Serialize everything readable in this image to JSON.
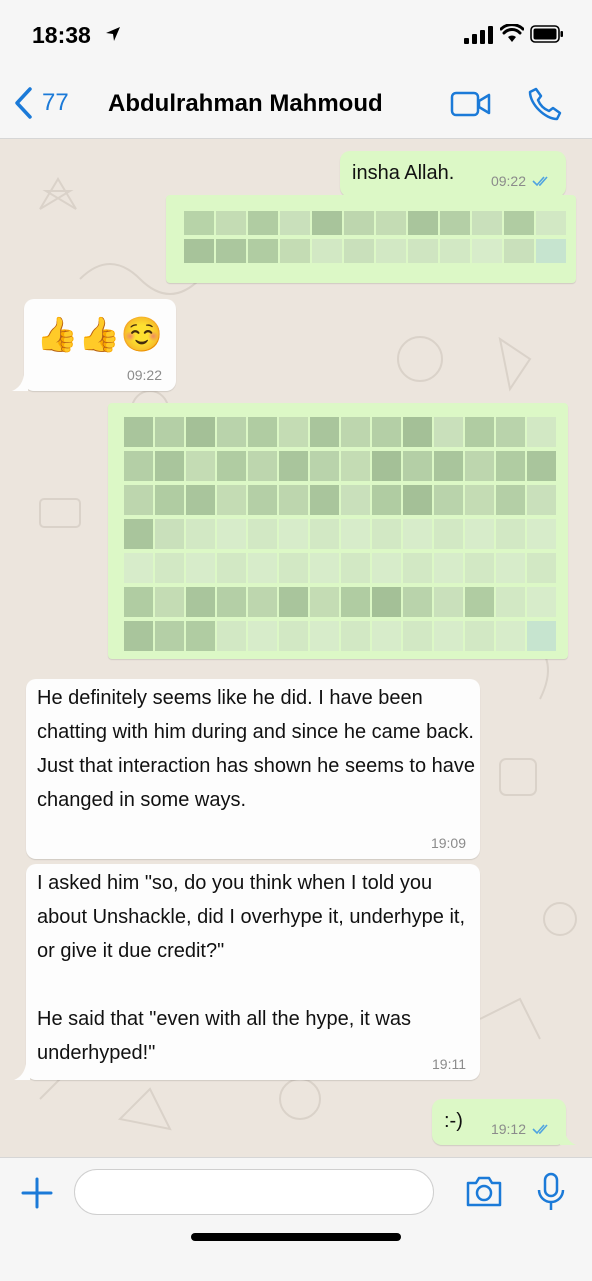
{
  "status": {
    "time": "18:38"
  },
  "header": {
    "back_count": "77",
    "contact_name": "Abdulrahman Mahmoud"
  },
  "messages": [
    {
      "direction": "out",
      "text": "insha Allah.",
      "time": "09:22",
      "read": true
    },
    {
      "direction": "out",
      "text": "",
      "time": "",
      "redacted": true
    },
    {
      "direction": "in",
      "text": "👍👍☺️",
      "time": "09:22"
    },
    {
      "direction": "out",
      "text": "",
      "time": "",
      "redacted": true
    },
    {
      "direction": "in",
      "text": "He definitely seems like he did. I have been chatting with him during and since he came back. Just that interaction has shown he seems to have changed in some ways.",
      "time": "19:09"
    },
    {
      "direction": "in",
      "text": "I asked him \"so, do you think when I told you about Unshackle, did I overhype it, underhype it, or give it due credit?\"\n\nHe said that \"even with all the hype, it was underhyped!\"",
      "time": "19:11"
    },
    {
      "direction": "out",
      "text": ":-)",
      "time": "19:12",
      "read": true
    }
  ],
  "input": {
    "placeholder": ""
  },
  "colors": {
    "accent": "#1b7ad8",
    "outgoing_bubble": "#dcf8c6",
    "incoming_bubble": "#fdfdfd",
    "chat_background": "#ece5dd",
    "read_ticks": "#4fa3e0"
  }
}
